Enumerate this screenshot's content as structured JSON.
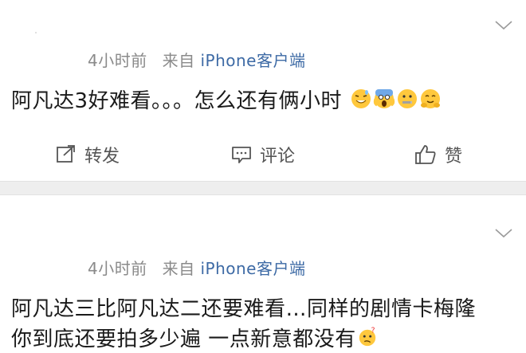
{
  "posts": [
    {
      "time": "4小时前",
      "source_prefix": "来自",
      "source_link": "iPhone客户端",
      "text": "阿凡达3好难看。。。怎么还有俩小时",
      "emojis": [
        "grinning-sweat-emoji",
        "screaming-emoji",
        "zipper-mouth-emoji",
        "hug-emoji"
      ]
    },
    {
      "time": "4小时前",
      "source_prefix": "来自",
      "source_link": "iPhone客户端",
      "text_line1": "阿凡达三比阿凡达二还要难看…同样的剧情卡梅隆",
      "text_line2": "你到底还要拍多少遍 一点新意都没有",
      "emojis": [
        "confused-emoji"
      ]
    }
  ],
  "actions": {
    "repost": "转发",
    "comment": "评论",
    "like": "赞"
  },
  "colors": {
    "link": "#3d6aa5",
    "meta": "#8a8a8a",
    "separator": "#eeeeee"
  }
}
